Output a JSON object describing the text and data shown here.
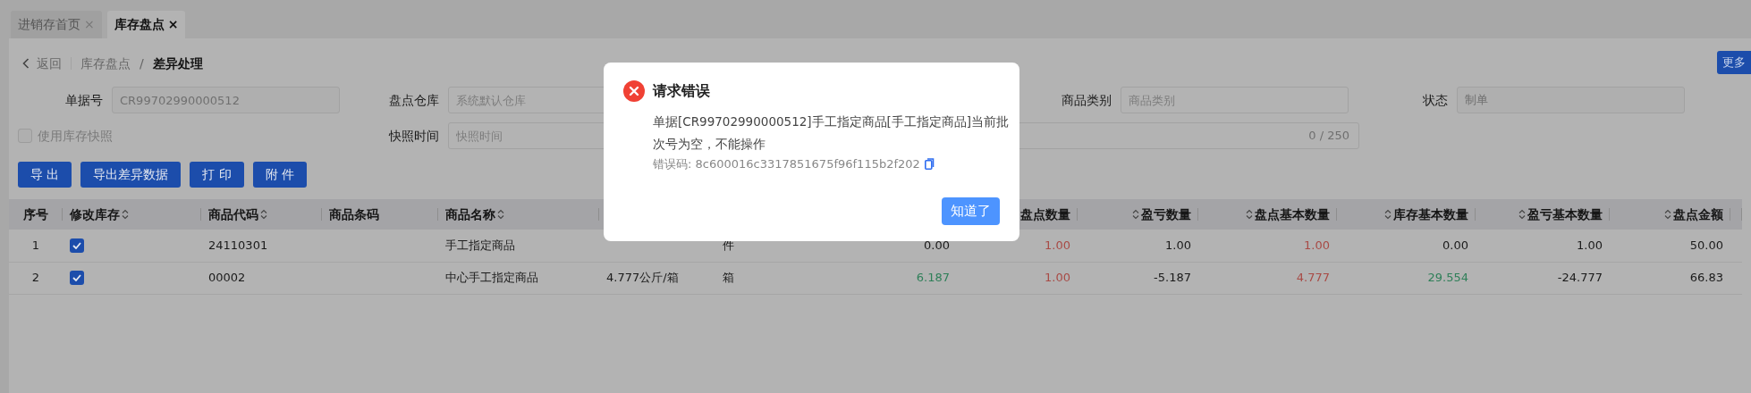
{
  "tabs": [
    {
      "label": "进销存首页",
      "close": "×",
      "selected": false
    },
    {
      "label": "库存盘点",
      "close": "×",
      "selected": true
    }
  ],
  "breadcrumb": {
    "back": "返回",
    "separator": "/",
    "items": [
      "库存盘点",
      "差异处理"
    ]
  },
  "more_button": "更多",
  "form": {
    "row_1": [
      {
        "label": "单据号",
        "value": "CR99702990000512",
        "disabled": true
      },
      {
        "label": "盘点仓库",
        "placeholder": "系统默认仓库"
      },
      {
        "label": "商品类别",
        "placeholder": "商品类别"
      },
      {
        "label": "状态",
        "value": "制单",
        "disabled": true
      }
    ],
    "snapshot": {
      "label": "使用库存快照",
      "checked": false,
      "disabled": true
    },
    "snapshot_time": {
      "label": "快照时间",
      "placeholder": "快照时间"
    },
    "remark_counter": "0 / 250"
  },
  "actions": [
    "导 出",
    "导出差异数据",
    "打 印",
    "附 件"
  ],
  "table": {
    "columns": [
      {
        "label": "序号",
        "sortable": false
      },
      {
        "label": "修改库存",
        "sortable": true
      },
      {
        "label": "商品代码",
        "sortable": true
      },
      {
        "label": "商品条码",
        "sortable": false
      },
      {
        "label": "商品名称",
        "sortable": true
      },
      {},
      {},
      {},
      {
        "label": "盘点数量",
        "sortable": false
      },
      {
        "label": "盈亏数量",
        "sortable": true
      },
      {
        "label": "盘点基本数量",
        "sortable": true
      },
      {
        "label": "库存基本数量",
        "sortable": true
      },
      {
        "label": "盈亏基本数量",
        "sortable": true
      },
      {
        "label": "盘点金额",
        "sortable": true
      }
    ],
    "rows": [
      {
        "cells": [
          {
            "text": "1"
          },
          {
            "checked": true
          },
          {
            "text": "24110301"
          },
          {
            "text": ""
          },
          {
            "text": "手工指定商品"
          },
          {
            "text": ""
          },
          {
            "text": "件"
          },
          {
            "text": "0.00"
          },
          {
            "text": "1.00",
            "color": "#a84a45"
          },
          {
            "text": "1.00"
          },
          {
            "text": "1.00",
            "color": "#a84a45"
          },
          {
            "text": "0.00"
          },
          {
            "text": "1.00"
          },
          {
            "text": "50.00"
          }
        ]
      },
      {
        "cells": [
          {
            "text": "2"
          },
          {
            "checked": true
          },
          {
            "text": "00002"
          },
          {
            "text": ""
          },
          {
            "text": "中心手工指定商品"
          },
          {
            "text": "4.777公斤/箱"
          },
          {
            "text": "箱"
          },
          {
            "text": "6.187",
            "color": "#2e7f58"
          },
          {
            "text": "1.00",
            "color": "#a84a45"
          },
          {
            "text": "-5.187"
          },
          {
            "text": "4.777",
            "color": "#a84a45"
          },
          {
            "text": "29.554",
            "color": "#2e7f58"
          },
          {
            "text": "-24.777"
          },
          {
            "text": "66.83"
          }
        ]
      }
    ]
  },
  "dialog": {
    "title": "请求错误",
    "message": "单据[CR99702990000512]手工指定商品[手工指定商品]当前批次号为空，不能操作",
    "error_code": "错误码: 8c600016c3317851675f96f115b2f202",
    "button": "知道了"
  }
}
